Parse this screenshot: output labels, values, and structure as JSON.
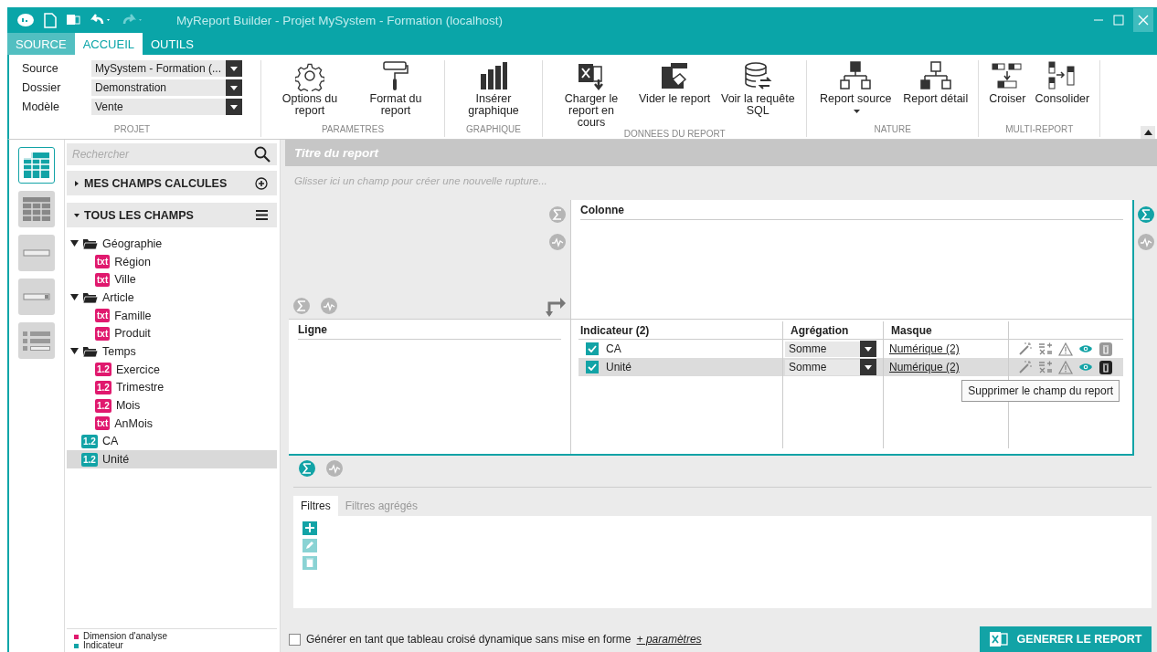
{
  "window": {
    "title": "MyReport Builder - Projet MySystem - Formation (localhost)"
  },
  "ribbon_tabs": [
    {
      "label": "SOURCE",
      "selected": false
    },
    {
      "label": "ACCUEIL",
      "selected": true
    },
    {
      "label": "OUTILS",
      "selected": false
    }
  ],
  "project": {
    "label": "PROJET",
    "fields": [
      {
        "label": "Source",
        "value": "MySystem - Formation (..."
      },
      {
        "label": "Dossier",
        "value": "Demonstration"
      },
      {
        "label": "Modèle",
        "value": "Vente"
      }
    ]
  },
  "ribbon_groups": [
    {
      "label": "PARAMETRES",
      "buttons": [
        {
          "label": "Options du report",
          "dropdown": false
        },
        {
          "label": "Format du report",
          "dropdown": false
        }
      ]
    },
    {
      "label": "GRAPHIQUE",
      "buttons": [
        {
          "label": "Insérer graphique",
          "dropdown": false
        }
      ]
    },
    {
      "label": "DONNEES DU REPORT",
      "buttons": [
        {
          "label": "Charger le report en cours",
          "dropdown": false
        },
        {
          "label": "Vider le report",
          "dropdown": false
        },
        {
          "label": "Voir la requête SQL",
          "dropdown": false
        }
      ]
    },
    {
      "label": "NATURE",
      "buttons": [
        {
          "label": "Report source",
          "dropdown": true
        },
        {
          "label": "Report détail",
          "dropdown": false
        }
      ]
    },
    {
      "label": "MULTI-REPORT",
      "buttons": [
        {
          "label": "Croiser",
          "dropdown": false
        },
        {
          "label": "Consolider",
          "dropdown": false
        }
      ]
    }
  ],
  "view_modes": [
    {
      "selected": true
    },
    {
      "selected": false
    },
    {
      "selected": false
    },
    {
      "selected": false
    },
    {
      "selected": false
    }
  ],
  "search": {
    "placeholder": "Rechercher"
  },
  "sections": [
    {
      "label": "MES CHAMPS CALCULES",
      "expanded": false
    },
    {
      "label": "TOUS LES CHAMPS",
      "expanded": true
    }
  ],
  "fields_tree": [
    {
      "label": "Géographie",
      "expanded": true,
      "children": [
        {
          "badge": "txt",
          "label": "Région",
          "color": "#e0196e",
          "selected": false
        },
        {
          "badge": "txt",
          "label": "Ville",
          "color": "#e0196e",
          "selected": false
        }
      ]
    },
    {
      "label": "Article",
      "expanded": true,
      "children": [
        {
          "badge": "txt",
          "label": "Famille",
          "color": "#e0196e",
          "selected": false
        },
        {
          "badge": "txt",
          "label": "Produit",
          "color": "#e0196e",
          "selected": false
        }
      ]
    },
    {
      "label": "Temps",
      "expanded": true,
      "children": [
        {
          "badge": "1.2",
          "label": "Exercice",
          "color": "#e0196e",
          "selected": false
        },
        {
          "badge": "1.2",
          "label": "Trimestre",
          "color": "#e0196e",
          "selected": false
        },
        {
          "badge": "1.2",
          "label": "Mois",
          "color": "#e0196e",
          "selected": false
        },
        {
          "badge": "txt",
          "label": "AnMois",
          "color": "#e0196e",
          "selected": false
        }
      ]
    },
    {
      "badge": "1.2",
      "label": "CA",
      "color": "#12a3a6",
      "selected": false
    },
    {
      "badge": "1.2",
      "label": "Unité",
      "color": "#12a3a6",
      "selected": true
    }
  ],
  "legend": [
    {
      "label": "Dimension d'analyse",
      "color": "#e0196e"
    },
    {
      "label": "Indicateur",
      "color": "#12a3a6"
    }
  ],
  "report": {
    "title_placeholder": "Titre du report",
    "drop_hint": "Glisser ici un champ pour créer une nouvelle rupture...",
    "column_zone": "Colonne",
    "row_zone": "Ligne",
    "indicator_columns": [
      "Indicateur (2)",
      "Agrégation",
      "Masque"
    ],
    "indicators": [
      {
        "name": "CA",
        "checked": true,
        "aggregation": "Somme",
        "mask": "Numérique (2)",
        "selected": false
      },
      {
        "name": "Unité",
        "checked": true,
        "aggregation": "Somme",
        "mask": "Numérique (2)",
        "selected": true
      }
    ],
    "tooltip": "Supprimer le champ du report"
  },
  "filter_tabs": [
    {
      "label": "Filtres",
      "selected": true
    },
    {
      "label": "Filtres agrégés",
      "selected": false
    }
  ],
  "pivot_option": {
    "checked": false,
    "label": "Générer en tant que tableau croisé dynamique sans mise en forme",
    "link": "+ paramètres"
  },
  "generate_button": "GENERER LE REPORT"
}
